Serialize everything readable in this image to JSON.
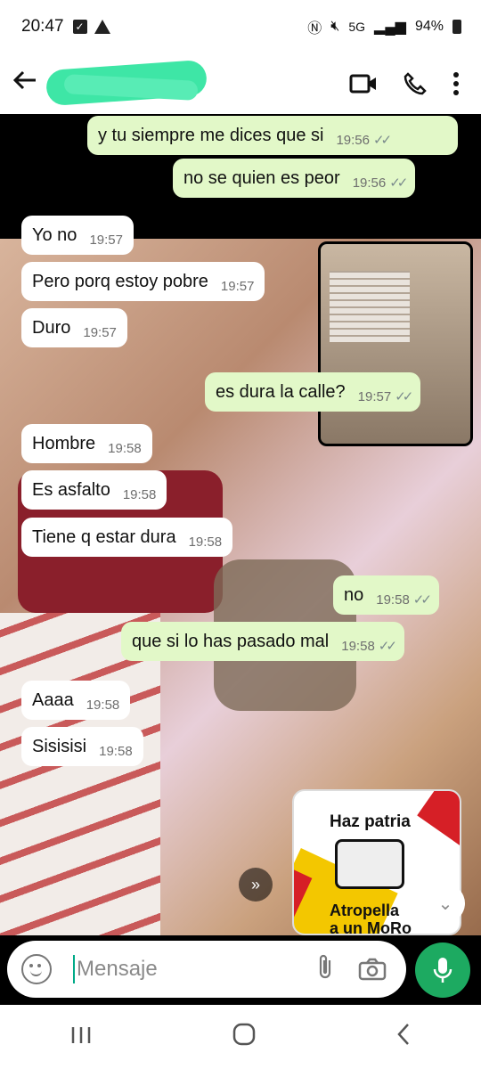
{
  "status_bar": {
    "time": "20:47",
    "network": "5G",
    "battery": "94%"
  },
  "header": {
    "back_icon": "arrow-left-icon",
    "video_icon": "video-call-icon",
    "phone_icon": "phone-icon",
    "menu_icon": "more-vert-icon",
    "accent": "#111111"
  },
  "messages": [
    {
      "dir": "out",
      "text": "y tu siempre me dices que si",
      "time": "19:56"
    },
    {
      "dir": "out",
      "text": "no se quien es peor",
      "time": "19:56"
    },
    {
      "dir": "in",
      "text": "Yo no",
      "time": "19:57"
    },
    {
      "dir": "in",
      "text": "Pero porq estoy pobre",
      "time": "19:57"
    },
    {
      "dir": "in",
      "text": "Duro",
      "time": "19:57"
    },
    {
      "dir": "out",
      "text": "es dura la calle?",
      "time": "19:57"
    },
    {
      "dir": "in",
      "text": "Hombre",
      "time": "19:58"
    },
    {
      "dir": "in",
      "text": "Es asfalto",
      "time": "19:58"
    },
    {
      "dir": "in",
      "text": "Tiene q estar dura",
      "time": "19:58"
    },
    {
      "dir": "out",
      "text": "no",
      "time": "19:58"
    },
    {
      "dir": "out",
      "text": "que si lo has pasado mal",
      "time": "19:58"
    },
    {
      "dir": "in",
      "text": "Aaaa",
      "time": "19:58"
    },
    {
      "dir": "in",
      "text": "Sisisisi",
      "time": "19:58"
    }
  ],
  "sticker": {
    "line1": "Haz patria",
    "line2": "Atropella",
    "line3": "a un MoRo"
  },
  "composer": {
    "placeholder": "Mensaje"
  },
  "colors": {
    "incoming": "#ffffff",
    "outgoing": "#e2f8c8",
    "mic": "#1daa61"
  }
}
